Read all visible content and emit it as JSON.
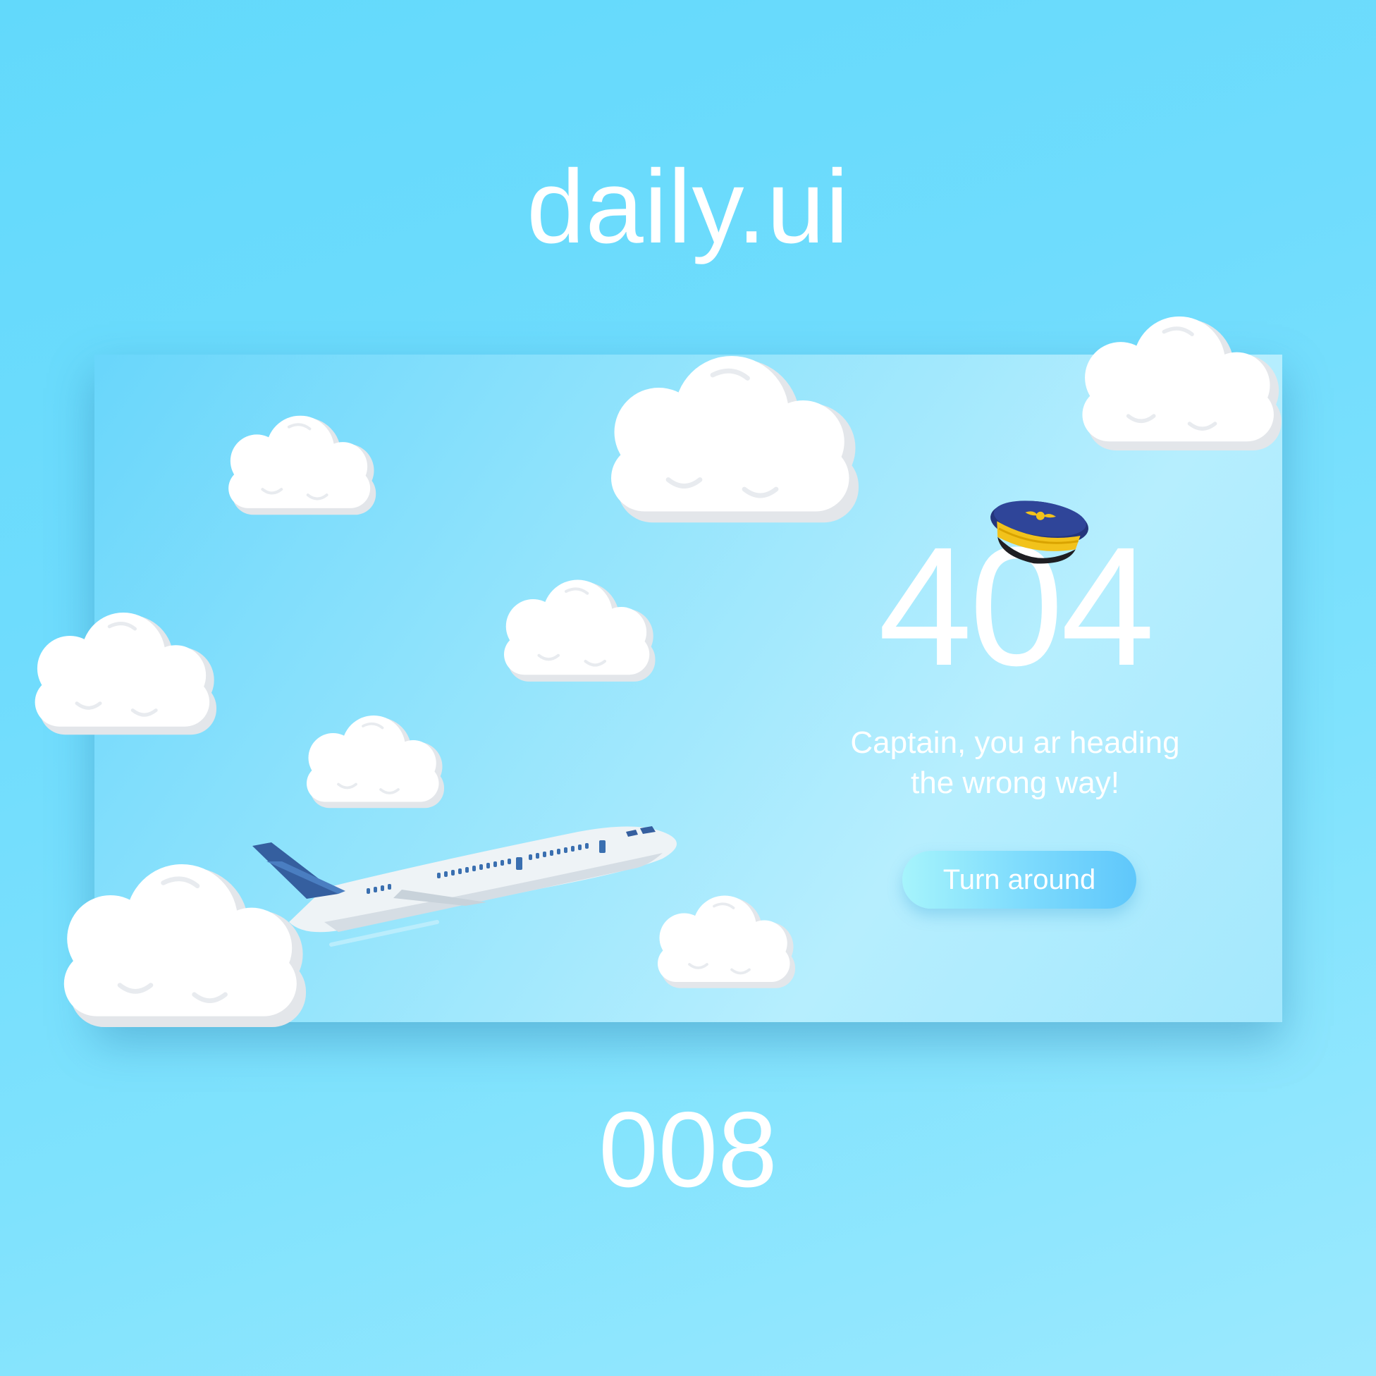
{
  "header": {
    "brand": "daily.ui"
  },
  "error_card": {
    "code": "404",
    "message_lines": [
      "Captain, you ar heading",
      "the wrong way!"
    ],
    "button_label": "Turn around"
  },
  "footer": {
    "issue_number": "008"
  },
  "icons": {
    "hat": "pilot-cap-icon",
    "plane": "airplane-icon",
    "cloud": "cloud-icon"
  },
  "colors": {
    "background": "#6fdcfd",
    "card": "#9de6fd",
    "text": "#ffffff",
    "button_start": "#a6f4fc",
    "button_end": "#5fc7fb",
    "plane_accent": "#3a6fb0",
    "cap_band": "#f2c21b",
    "cap_crown": "#283f8e"
  }
}
